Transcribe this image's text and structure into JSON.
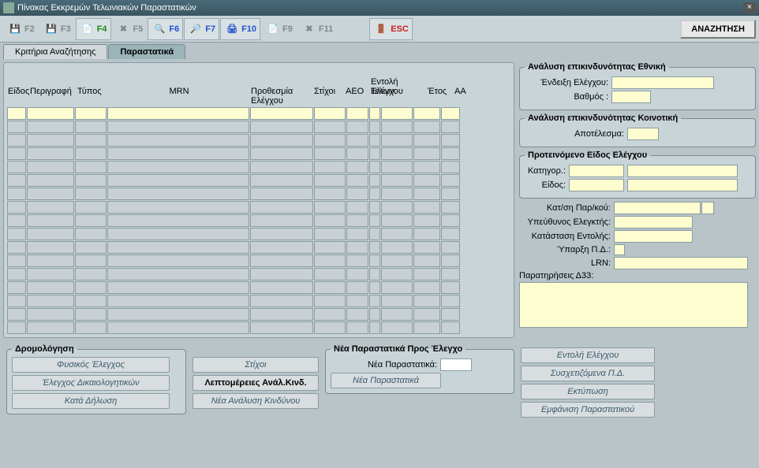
{
  "window": {
    "title": "Πίνακας Εκκρεμών Τελωνιακών Παραστατικών"
  },
  "toolbar": {
    "f2": "F2",
    "f3": "F3",
    "f4": "F4",
    "f5": "F5",
    "f6": "F6",
    "f7": "F7",
    "f10": "F10",
    "f9": "F9",
    "f11": "F11",
    "esc": "ESC",
    "search": "ΑΝΑΖΗΤΗΣΗ"
  },
  "tabs": {
    "criteria": "Κριτήρια Αναζήτησης",
    "docs": "Παραστατικά"
  },
  "grid": {
    "h_eidos": "Είδος",
    "h_perigrafi": "Περιγραφή",
    "h_typos": "Τύπος",
    "h_mrn": "MRN",
    "h_prothesmia": "Προθεσμία Ελέγχου",
    "h_stixoi": "Στίχοι",
    "h_aeo": "AEO",
    "h_entoli": "Εντολή Ελέγχου",
    "h_telon": "Τελων.",
    "h_etos": "Έτος",
    "h_aa": "ΑΑ"
  },
  "risk_national": {
    "legend": "Ανάλυση επικινδυνότητας Εθνική",
    "ind_label": "Ένδειξη Ελέγχου:",
    "grade_label": "Βαθμός :"
  },
  "risk_eu": {
    "legend": "Ανάλυση επικινδυνότητας Κοινοτική",
    "result_label": "Αποτέλεσμα:"
  },
  "proposed": {
    "legend": "Προτεινόμενο Είδος Ελέγχου",
    "cat_label": "Κατηγορ.:",
    "kind_label": "Είδος:"
  },
  "misc": {
    "katsi": "Κατ/ση Παρ/κού:",
    "ypeuth": "Υπεύθυνος Ελεγκτής:",
    "katast": "Κατάσταση Εντολής:",
    "yparxi": "Ύπαρξη Π.Δ.:",
    "lrn": "LRN:",
    "paratir": "Παρατηρήσεις Δ33:"
  },
  "routing": {
    "legend": "Δρομολόγηση",
    "physical": "Φυσικός Έλεγχος",
    "docs": "Έλεγχος Δικαιολογητικών",
    "decl": "Κατά Δήλωση"
  },
  "mid": {
    "stixoi": "Στίχοι",
    "details": "Λεπτομέρειες Ανάλ.Κινδ.",
    "newrisk": "Νέα Ανάλυση Κινδύνου"
  },
  "newdocs": {
    "legend": "Νέα Παραστατικά Προς Έλεγχο",
    "label": "Νέα Παραστατικά:",
    "btn": "Νέα Παραστατικά"
  },
  "rbuttons": {
    "entoli": "Εντολή Ελέγχου",
    "sysx": "Συσχετιζόμενα Π.Δ.",
    "print": "Εκτύπωση",
    "show": "Εμφάνιση Παραστατικού"
  }
}
